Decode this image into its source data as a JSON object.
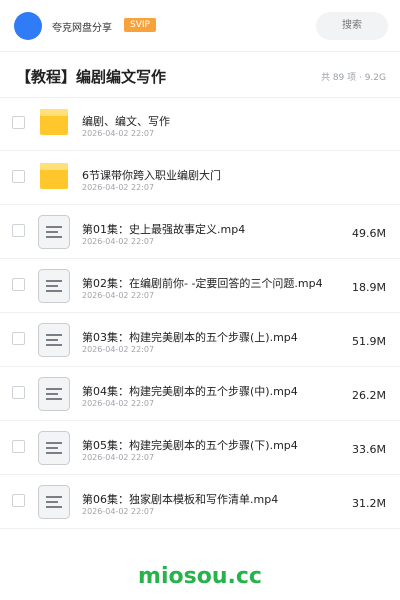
{
  "header": {
    "app_name": "夸克网盘分享",
    "badge": "SVIP",
    "search_placeholder": "搜索"
  },
  "title_row": {
    "title": "【教程】编剧编文写作",
    "stats": "共 89 项 · 9.2G"
  },
  "folders": [
    {
      "name": "编剧、编文、写作",
      "date": "2026-04-02 22:07"
    },
    {
      "name": "6节课带你跨入职业编剧大门",
      "date": "2026-04-02 22:07"
    }
  ],
  "files": [
    {
      "name": "第01集：史上最强故事定义.mp4",
      "date": "2026-04-02 22:07",
      "size": "49.6M"
    },
    {
      "name": "第02集：在编剧前你- -定要回答的三个问题.mp4",
      "date": "2026-04-02 22:07",
      "size": "18.9M"
    },
    {
      "name": "第03集：构建完美剧本的五个步骤(上).mp4",
      "date": "2026-04-02 22:07",
      "size": "51.9M"
    },
    {
      "name": "第04集：构建完美剧本的五个步骤(中).mp4",
      "date": "2026-04-02 22:07",
      "size": "26.2M"
    },
    {
      "name": "第05集：构建完美剧本的五个步骤(下).mp4",
      "date": "2026-04-02 22:07",
      "size": "33.6M"
    },
    {
      "name": "第06集：独家剧本模板和写作清单.mp4",
      "date": "2026-04-02 22:07",
      "size": "31.2M"
    }
  ],
  "watermark": "miosou.cc",
  "colors": {
    "accent_blue": "#2f7cf6",
    "svip_orange": "#f7a23a",
    "folder_yellow": "#ffc72c",
    "watermark_green": "#27b24a"
  }
}
